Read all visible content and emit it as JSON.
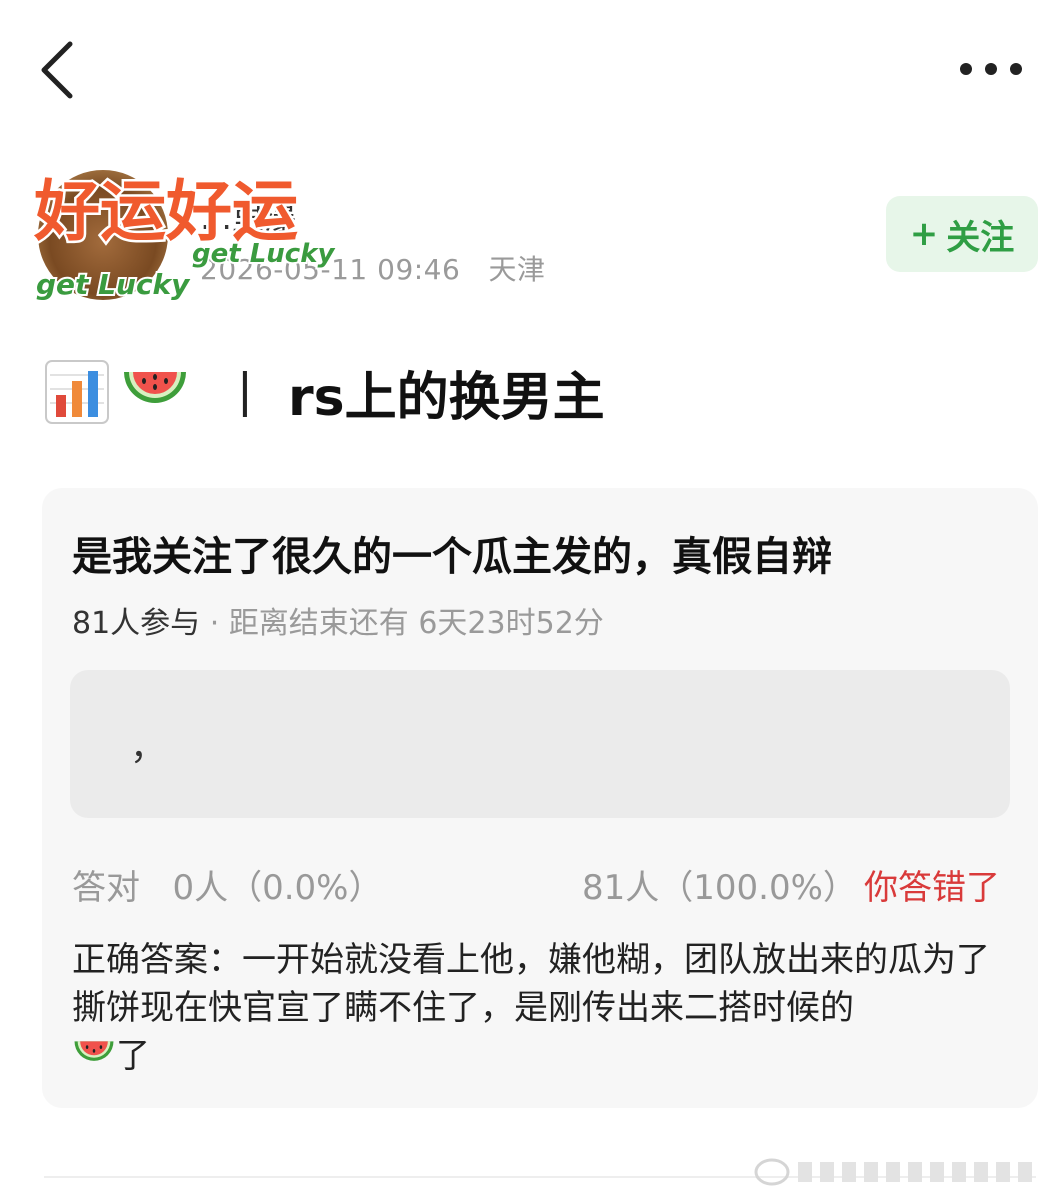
{
  "nav": {
    "back_icon": "chevron-left-icon",
    "more_icon": "more-dots-icon"
  },
  "author": {
    "name": "…里瀑",
    "timestamp": "2026-05-11 09:46",
    "location": "天津",
    "follow_plus": "+",
    "follow_label": "关注",
    "sticker_line1": "好运好运",
    "sticker_line2": "get Lucky",
    "sticker_line3": "get Lucky"
  },
  "post": {
    "title_icons": [
      "bar-chart-icon",
      "watermelon-icon"
    ],
    "separator": "丨",
    "title": "rs上的换男主"
  },
  "quiz": {
    "question": "是我关注了很久的一个瓜主发的，真假自辩",
    "participants": "81人参与",
    "dot": " · ",
    "countdown": "距离结束还有 6天23时52分",
    "option_text": "，",
    "correct_label": "答对",
    "correct_value": "0人（0.0%）",
    "wrong_value": "81人（100.0%）",
    "wrong_status": "你答错了",
    "answer_text": "正确答案：一开始就没看上他，嫌他糊，团队放出来的瓜为了撕饼现在快官宣了瞒不住了，是刚传出来二搭时候的",
    "answer_end": "了"
  },
  "colors": {
    "accent_green": "#2f9e44",
    "follow_bg": "#e7f6e9",
    "wrong_red": "#d93a3a",
    "card_bg": "#f7f7f7"
  }
}
